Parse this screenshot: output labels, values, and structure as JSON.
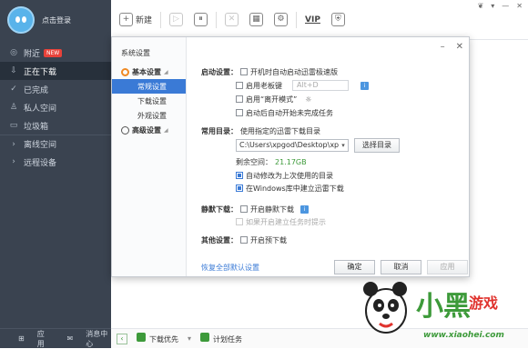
{
  "sidebar": {
    "login": "点击登录",
    "items": [
      {
        "label": "附近",
        "badge": "NEW",
        "icon": "location-icon"
      },
      {
        "label": "正在下载",
        "icon": "download-icon"
      },
      {
        "label": "已完成",
        "icon": "check-icon"
      },
      {
        "label": "私人空间",
        "icon": "user-icon"
      },
      {
        "label": "垃圾箱",
        "icon": "trash-icon"
      },
      {
        "label": "离线空间",
        "icon": "cloud-icon"
      },
      {
        "label": "远程设备",
        "icon": "device-icon"
      }
    ],
    "footer": {
      "apps": "应用",
      "messages": "消息中心"
    }
  },
  "toolbar": {
    "new": "新建",
    "vip": "VIP"
  },
  "dialog": {
    "tree": {
      "title": "系统设置",
      "basic": "基本设置",
      "general": "常规设置",
      "download": "下载设置",
      "appearance": "外观设置",
      "advanced": "高级设置"
    },
    "startup": {
      "label": "启动设置：",
      "opt1": "开机时自动启动迅雷极速版",
      "opt2": "启用老板键",
      "hotkey": "Alt+D",
      "opt3": "启用“离开模式”",
      "opt4": "启动后自动开始未完成任务"
    },
    "dir": {
      "label": "常用目录：",
      "desc": "使用指定的迅雷下载目录",
      "path": "C:\\Users\\xpgod\\Desktop\\xp",
      "select": "选择目录",
      "space_label": "剩余空间：",
      "space_value": "21.17GB",
      "opt1": "自动修改为上次使用的目录",
      "opt2": "在Windows库中建立迅雷下载"
    },
    "silent": {
      "label": "静默下载：",
      "opt1": "开启静默下载",
      "opt2": "如果开启建立任务时提示"
    },
    "other": {
      "label": "其他设置：",
      "opt1": "开启预下载"
    },
    "reset": "恢复全部默认设置",
    "ok": "确定",
    "cancel": "取消",
    "apply": "应用"
  },
  "bottom": {
    "priority": "下载优先",
    "plan": "计划任务"
  },
  "watermark": {
    "brand": "小黑",
    "brand2": "游戏",
    "url": "www.xiaohei.com"
  },
  "colors": {
    "sidebar": "#3a4350",
    "accent": "#3a7ad6",
    "green": "#3d9a3a"
  }
}
